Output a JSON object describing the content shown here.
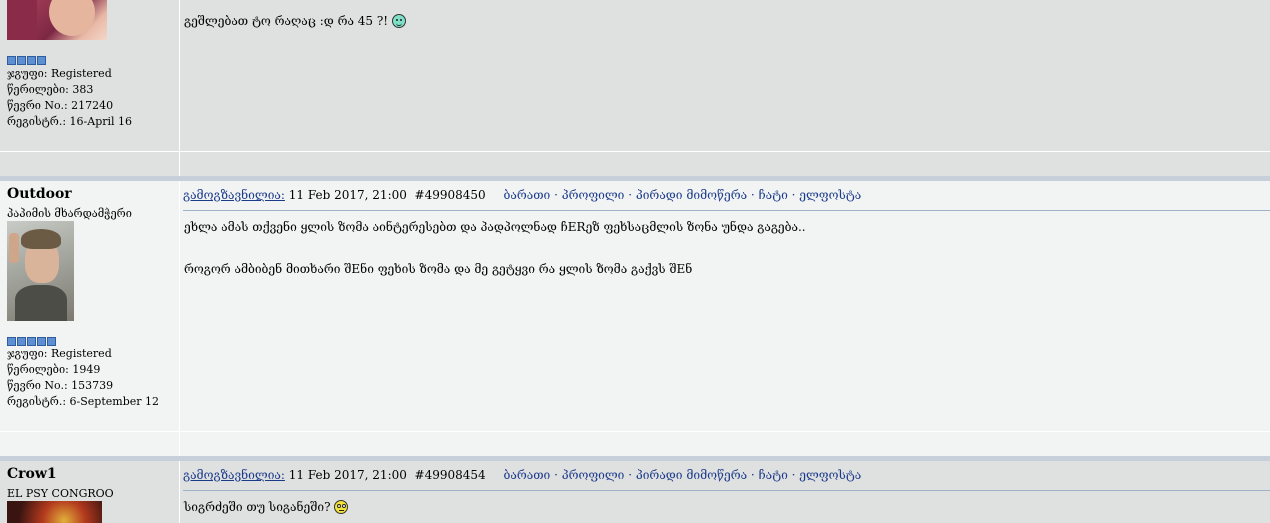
{
  "posts": [
    {
      "username": "",
      "user_title": "",
      "rank_stars": 4,
      "info": {
        "group": "ჯგუფი: Registered",
        "posts": "წერილები: 383",
        "member_no": "წევრი No.: 217240",
        "registered": "რეგისტრ.: 16-April 16"
      },
      "message_lines": [
        "გეშლებათ ტო რაღაც :დ რა 45 ?!"
      ],
      "smiley": "smiley-icon-teal"
    },
    {
      "username": "Outdoor",
      "user_title": "პაპიმის მხარდამჭერი",
      "rank_stars": 5,
      "info": {
        "group": "ჯგუფი: Registered",
        "posts": "წერილები: 1949",
        "member_no": "წევრი No.: 153739",
        "registered": "რეგისტრ.: 6-September 12"
      },
      "header": {
        "posted_label": "გამოგზავნილია:",
        "date": "11 Feb 2017, 21:00",
        "post_id": "#49908450",
        "menu": [
          "ბარათი",
          "პროფილი",
          "პირადი მიმოწერა",
          "ჩატი",
          "ელფოსტა"
        ]
      },
      "message_lines": [
        "ეხლა ამას თქვენი ყლის ზომა აინტერესებთ და პადპოლნად ჩERეზ ფეხსაცმლის ზონა უნდა გაგება..",
        "როგორ ამბიბენ მითხარი შEნი ფეხის ზომა და მე გეტყვი რა ყლის ზომა გაქვს შEნ"
      ]
    },
    {
      "username": "Crow1",
      "user_title": "EL PSY CONGROO",
      "header": {
        "posted_label": "გამოგზავნილია:",
        "date": "11 Feb 2017, 21:00",
        "post_id": "#49908454",
        "menu": [
          "ბარათი",
          "პროფილი",
          "პირადი მიმოწერა",
          "ჩატი",
          "ელფოსტა"
        ]
      },
      "message_lines": [
        "სიგრძეში თუ სიგანეში?"
      ],
      "smiley": "smiley-icon-yellow"
    }
  ],
  "menu_separator": "·"
}
